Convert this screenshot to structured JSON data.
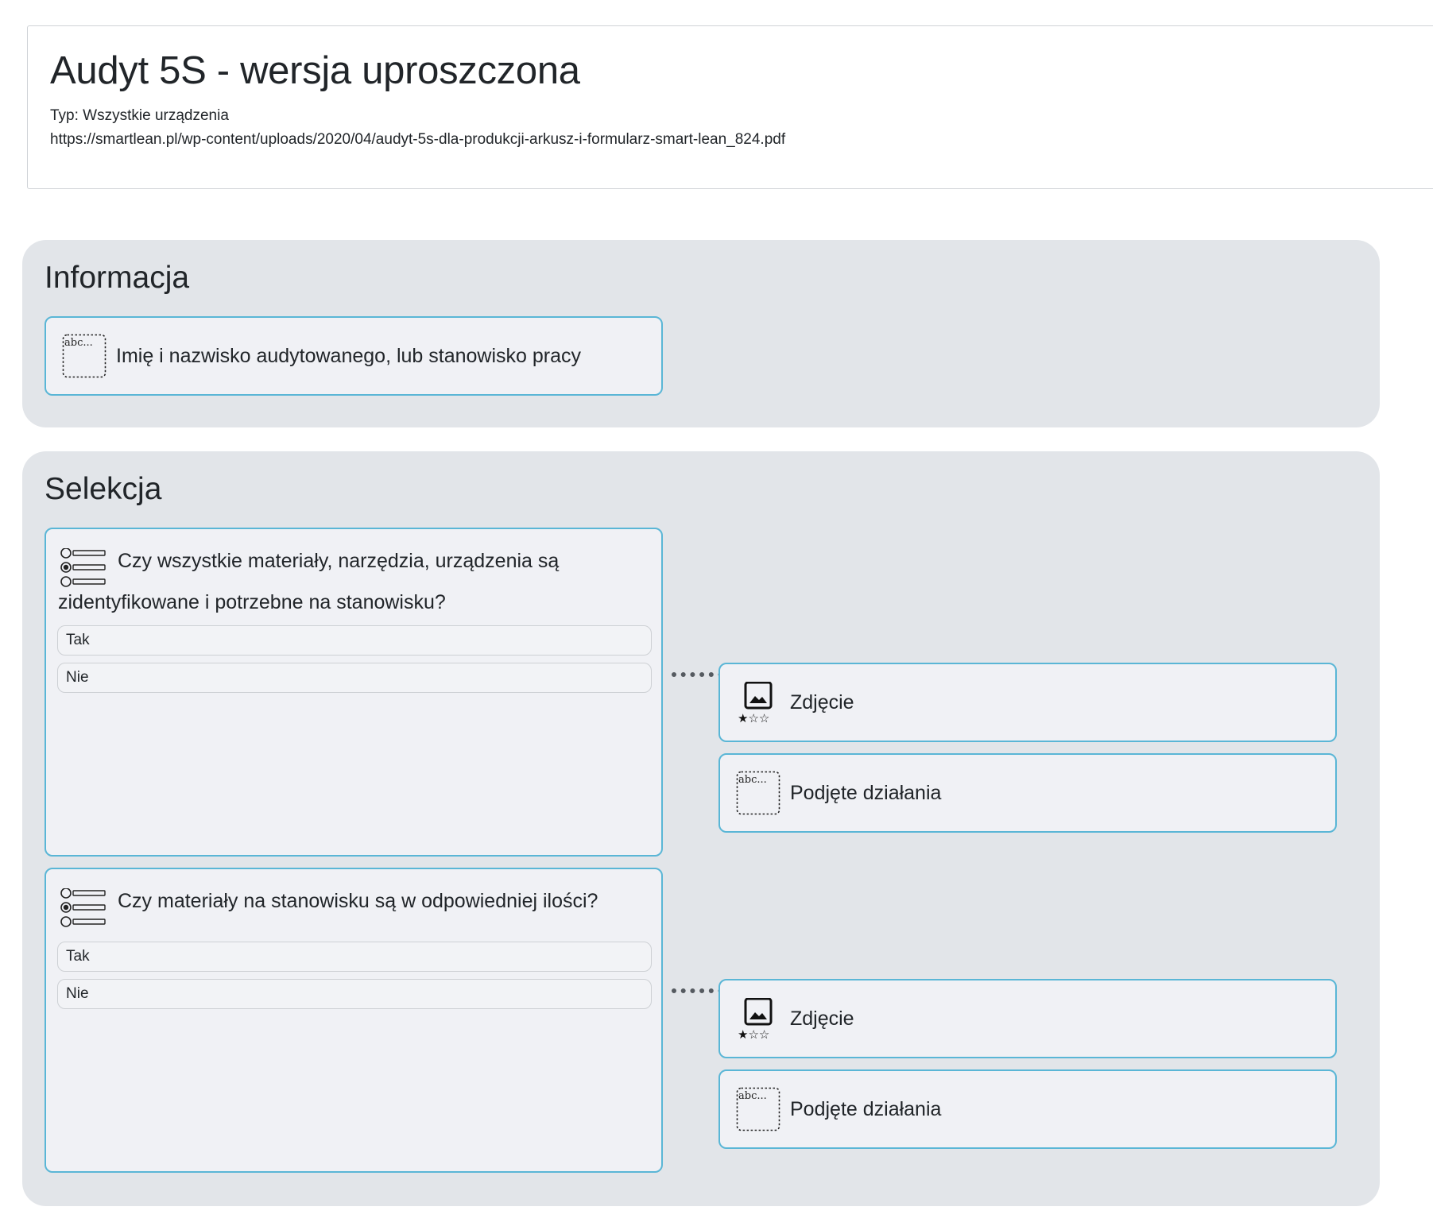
{
  "header": {
    "title": "Audyt 5S - wersja uproszczona",
    "type_line": "Typ: Wszystkie urządzenia",
    "url": "https://smartlean.pl/wp-content/uploads/2020/04/audyt-5s-dla-produkcji-arkusz-i-formularz-smart-lean_824.pdf"
  },
  "sections": [
    {
      "title": "Informacja",
      "fields": [
        {
          "icon": "text-input-icon",
          "label": "Imię i nazwisko audytowanego, lub stanowisko pracy"
        }
      ]
    },
    {
      "title": "Selekcja",
      "questions": [
        {
          "icon": "single-choice-icon",
          "text": "Czy wszystkie materiały, narzędzia, urządzenia są zidentyfikowane i potrzebne na stanowisku?",
          "answers": [
            "Tak",
            "Nie"
          ],
          "followups": [
            {
              "icon": "photo-rating-icon",
              "label": "Zdjęcie"
            },
            {
              "icon": "text-input-icon",
              "label": "Podjęte działania"
            }
          ]
        },
        {
          "icon": "single-choice-icon",
          "text": "Czy materiały na stanowisku są w odpowiedniej ilości?",
          "answers": [
            "Tak",
            "Nie"
          ],
          "followups": [
            {
              "icon": "photo-rating-icon",
              "label": "Zdjęcie"
            },
            {
              "icon": "text-input-icon",
              "label": "Podjęte działania"
            }
          ]
        }
      ]
    }
  ],
  "icon_text": {
    "abc": "abc..."
  },
  "colors": {
    "accent_border": "#5ab6d6",
    "section_bg": "#e2e5e9",
    "card_bg": "#f0f1f5"
  }
}
